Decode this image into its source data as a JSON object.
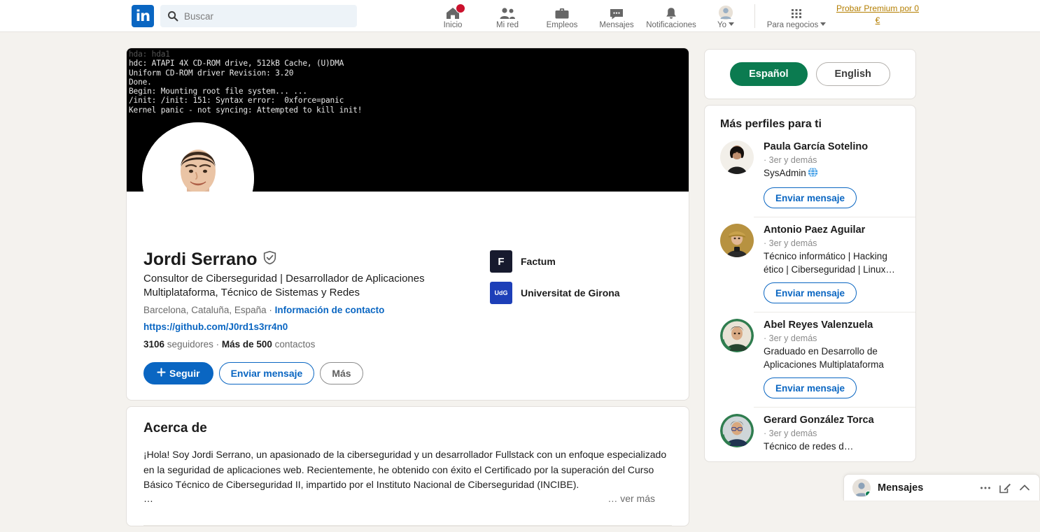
{
  "nav": {
    "logo": "in",
    "search": {
      "placeholder": "Buscar",
      "value": "",
      "icon": "search-icon"
    },
    "items": [
      {
        "label": "Inicio",
        "icon": "home-icon",
        "badge": ""
      },
      {
        "label": "Mi red",
        "icon": "network-icon",
        "badge": ""
      },
      {
        "label": "Empleos",
        "icon": "briefcase-icon",
        "badge": ""
      },
      {
        "label": "Mensajes",
        "icon": "message-icon",
        "badge": ""
      },
      {
        "label": "Notificaciones",
        "icon": "bell-icon",
        "badge": ""
      },
      {
        "label": "Yo",
        "icon": "avatar-icon",
        "badge": ""
      },
      {
        "label": "Para negocios",
        "icon": "grid-icon",
        "badge": ""
      }
    ],
    "premium_link": "Probar Premium por 0 €"
  },
  "banner": {
    "lines": [
      "hda: hda1",
      "hdc: ATAPI 4X CD-ROM drive, 512kB Cache, (U)DMA",
      "Uniform CD-ROM driver Revision: 3.20",
      "Done.",
      "Begin: Mounting root file system... ...",
      "/init: /init: 151: Syntax error:  0xforce=panic",
      "Kernel panic - not syncing: Attempted to kill init!"
    ]
  },
  "profile": {
    "name": "Jordi Serrano",
    "verified_icon": "verified-shield-icon",
    "headline": "Consultor de Ciberseguridad | Desarrollador de Aplicaciones Multiplataforma, Técnico de Sistemas y Redes",
    "location": "Barcelona, Cataluña, España",
    "separator": " · ",
    "contact_link": "Información de contacto",
    "website": "https://github.com/J0rd1s3rr4n0",
    "followers_count": "3106",
    "followers_label": " seguidores ",
    "dot": " · ",
    "connections_count": "Más de 500",
    "connections_label": " contactos",
    "buttons": {
      "follow": "Seguir",
      "follow_icon": "plus-icon",
      "message": "Enviar mensaje",
      "more": "Más"
    },
    "orgs": [
      {
        "name": "Factum",
        "logo_text": "F",
        "logo_color": "#171a2e"
      },
      {
        "name": "Universitat de Girona",
        "logo_text": "UdG",
        "logo_color": "#1d3fb8"
      }
    ]
  },
  "about": {
    "title": "Acerca de",
    "text": "¡Hola! Soy Jordi Serrano, un apasionado de la ciberseguridad y un desarrollador Fullstack con un enfoque especializado en la seguridad de aplicaciones web. Recientemente, he obtenido con éxito el Certificado por la superación del Curso Básico Técnico de Ciberseguridad II, impartido por el Instituto Nacional de Ciberseguridad (INCIBE).",
    "ellipsis": "…",
    "see_more": "… ver más"
  },
  "sidebar": {
    "language": {
      "active": "Español",
      "inactive": "English",
      "active_color": "#0b7b50"
    },
    "more_profiles_title": "Más perfiles para ti",
    "profiles": [
      {
        "name": "Paula García Sotelino",
        "degree": "· 3er y demás",
        "headline": "SysAdmin",
        "has_globe": true,
        "button": "Enviar mensaje",
        "avatar_kind": "woman-dark-hair"
      },
      {
        "name": "Antonio Paez Aguilar",
        "degree": "· 3er y demás",
        "headline": "Técnico informático | Hacking ético | Ciberseguridad | Linux…",
        "has_globe": false,
        "button": "Enviar mensaje",
        "avatar_kind": "person-cap"
      },
      {
        "name": "Abel Reyes Valenzuela",
        "degree": "· 3er y demás",
        "headline": "Graduado en Desarrollo de Aplicaciones Multiplataforma",
        "has_globe": false,
        "button": "Enviar mensaje",
        "avatar_kind": "man-green-ring"
      },
      {
        "name": "Gerard González Torca",
        "degree": "· 3er y demás",
        "headline": "Técnico de redes d…",
        "has_globe": false,
        "button": "",
        "avatar_kind": "man-glasses-green-ring"
      }
    ]
  },
  "messaging": {
    "label": "Mensajes",
    "more_icon": "ellipsis-icon",
    "compose_icon": "compose-icon",
    "expand_icon": "chevron-up-icon",
    "online": true
  }
}
